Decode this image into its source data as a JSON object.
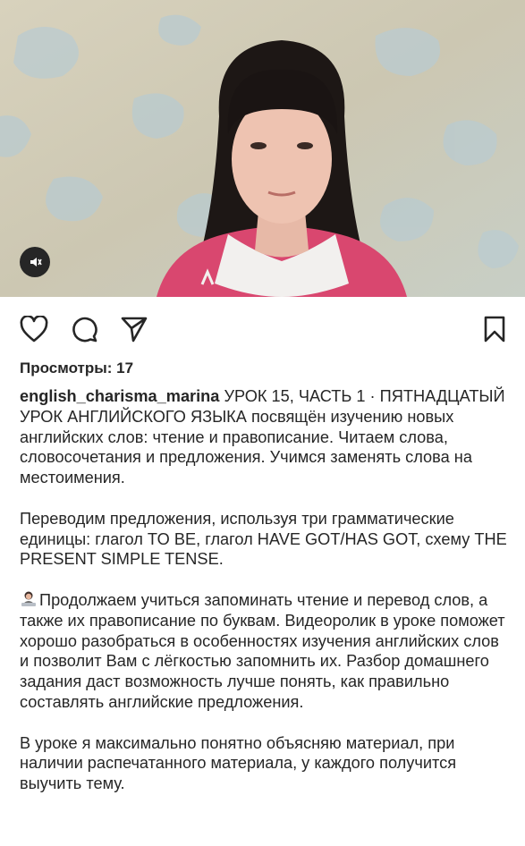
{
  "post": {
    "views_label": "Просмотры: 17",
    "username": "english_charisma_marina",
    "caption_first": " УРОК 15, ЧАСТЬ 1 · ПЯТНАДЦАТЫЙ УРОК АНГЛИЙСКОГО ЯЗЫКА посвящён изучению новых английских слов: чтение и правописание. Читаем слова, словосочетания и предложения. Учимся заменять слова на местоимения.",
    "paragraph_2": "Переводим предложения, используя три грамматические единицы: глагол TO BE, глагол HAVE GOT/HAS GOT, схему THE PRESENT SIMPLE TENSE.",
    "paragraph_3": "Продолжаем учиться запоминать чтение и перевод слов, а также их правописание по буквам. Видеоролик в уроке поможет хорошо разобраться в особенностях изучения английских слов и позволит Вам с лёгкостью запомнить их. Разбор домашнего задания даст возможность лучше понять, как правильно составлять английские предложения.",
    "paragraph_4": "В уроке я максимально понятно объясняю материал, при наличии распечатанного материала, у каждого получится выучить тему."
  },
  "icons": {
    "like": "heart-icon",
    "comment": "comment-icon",
    "share": "send-icon",
    "save": "bookmark-icon",
    "sound": "sound-icon",
    "emoji": "person-at-laptop-emoji"
  },
  "colors": {
    "text": "#262626",
    "sweater": "#d9476f",
    "wall": "#cfcab8"
  }
}
